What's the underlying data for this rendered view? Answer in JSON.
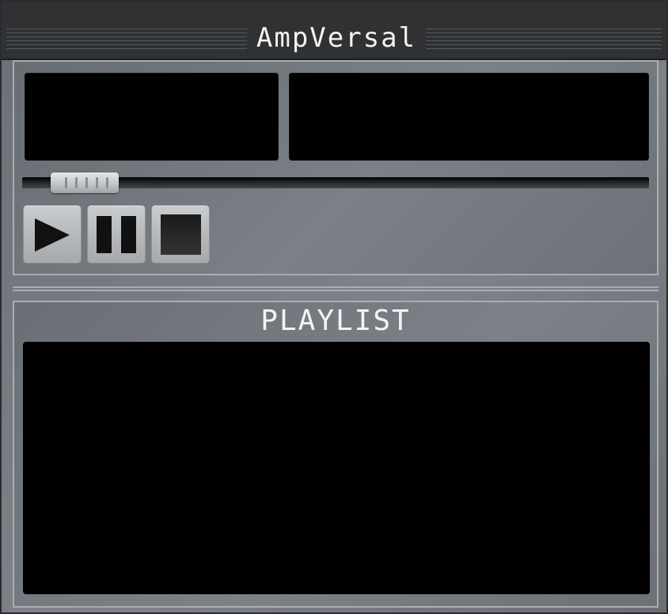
{
  "app": {
    "title": "AmpVersal"
  },
  "player": {
    "displays": [
      {
        "name": "track-info-display",
        "text": ""
      },
      {
        "name": "time-display",
        "text": ""
      }
    ],
    "seek": {
      "position": 0.05
    },
    "controls": [
      {
        "name": "play-button",
        "icon": "play-icon"
      },
      {
        "name": "pause-button",
        "icon": "pause-icon"
      },
      {
        "name": "stop-button",
        "icon": "stop-icon"
      }
    ]
  },
  "playlist": {
    "title": "PLAYLIST",
    "items": []
  },
  "colors": {
    "panel": "#767b81",
    "titlebar": "#2f3133",
    "display": "#000000",
    "button": "#b8bbbe",
    "icon": "#111111"
  }
}
